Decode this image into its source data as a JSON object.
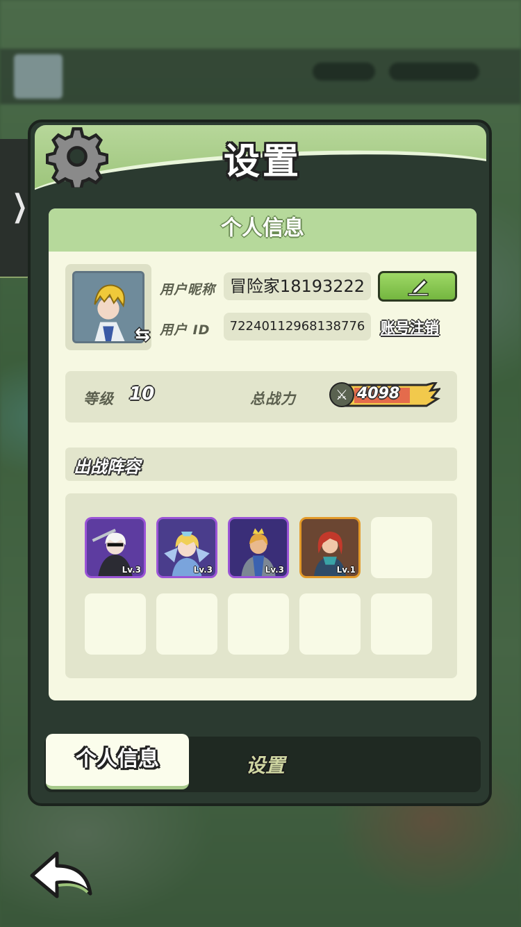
{
  "dialog": {
    "title": "设置",
    "panel_title": "个人信息"
  },
  "profile": {
    "nickname_label": "用户昵称",
    "nickname": "冒险家18193222",
    "id_label": "用户 ID",
    "user_id": "72240112968138776",
    "cancel_account": "账号注销",
    "level_label": "等级",
    "level": "10",
    "power_label": "总战力",
    "power": "4098"
  },
  "lineup": {
    "title": "出战阵容",
    "heroes": [
      {
        "level": "Lv.3",
        "rarity": "purple"
      },
      {
        "level": "Lv.3",
        "rarity": "purple"
      },
      {
        "level": "Lv.3",
        "rarity": "purple"
      },
      {
        "level": "Lv.1",
        "rarity": "orange"
      }
    ],
    "empty_slots": 6
  },
  "tabs": {
    "active": "个人信息",
    "inactive": "设置"
  },
  "icons": {
    "gear": "gear-icon",
    "edit": "pencil-icon",
    "swap": "swap-arrow-icon",
    "back": "back-arrow-icon",
    "expand": "chevron-right-icon",
    "power": "crossed-swords-icon"
  },
  "colors": {
    "header_green": "#9cc47a",
    "panel_bg": "#f6f8e2",
    "field_bg": "#e2e5cc",
    "edit_green": "#74b640",
    "power_yellow": "#f2c94c",
    "purple_frame": "#9a54d6",
    "orange_frame": "#e39a2a"
  }
}
